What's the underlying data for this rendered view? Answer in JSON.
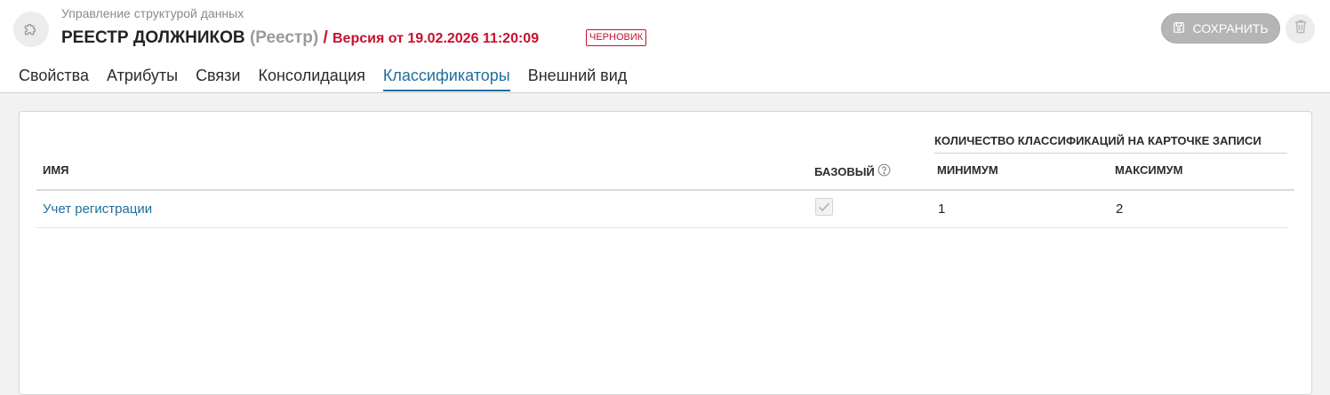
{
  "header": {
    "breadcrumb": "Управление структурой данных",
    "entity_name": "РЕЕСТР ДОЛЖНИКОВ",
    "entity_type": "(Реестр)",
    "separator": "/",
    "version": "Версия от 19.02.2026 11:20:09",
    "status_badge": "ЧЕРНОВИК",
    "save_label": "СОХРАНИТЬ",
    "app_icon": "puzzle-icon",
    "save_icon": "floppy-disk-icon",
    "delete_icon": "trash-icon"
  },
  "tabs": [
    {
      "label": "Свойства",
      "active": false
    },
    {
      "label": "Атрибуты",
      "active": false
    },
    {
      "label": "Связи",
      "active": false
    },
    {
      "label": "Консолидация",
      "active": false
    },
    {
      "label": "Классификаторы",
      "active": true
    },
    {
      "label": "Внешний вид",
      "active": false
    }
  ],
  "table": {
    "group_header": "КОЛИЧЕСТВО КЛАССИФИКАЦИЙ НА КАРТОЧКЕ ЗАПИСИ",
    "columns": {
      "name": "ИМЯ",
      "base": "БАЗОВЫЙ",
      "min": "МИНИМУМ",
      "max": "МАКСИМУМ"
    },
    "help_icon": "question-circle-icon",
    "rows": [
      {
        "name": "Учет регистрации",
        "base": true,
        "min": "1",
        "max": "2"
      }
    ]
  },
  "colors": {
    "accent": "#1f6e9c",
    "danger": "#c8102e",
    "disabled": "#b5b5b5"
  }
}
